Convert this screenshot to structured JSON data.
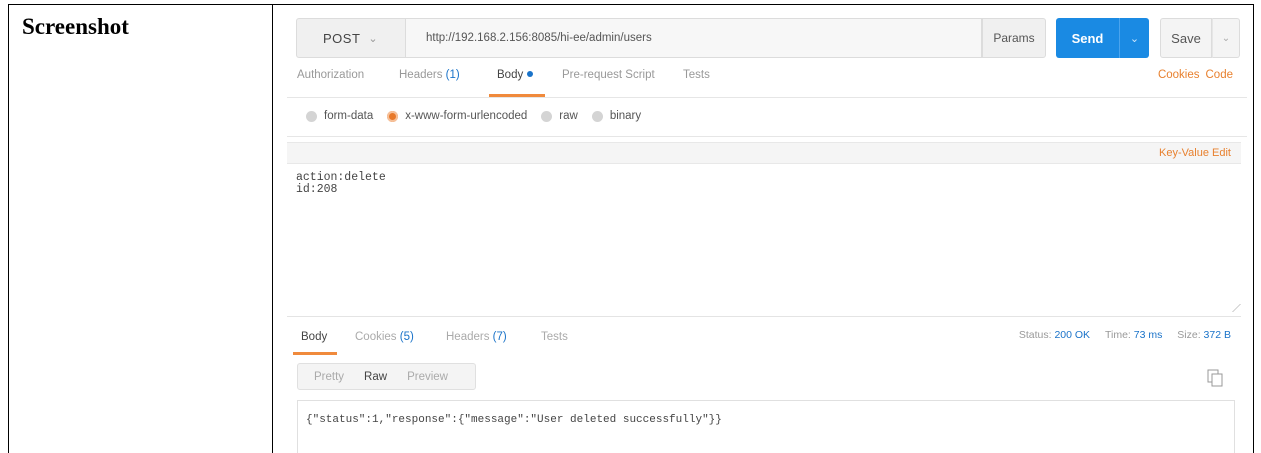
{
  "doc": {
    "label": "Screenshot"
  },
  "request": {
    "method": "POST",
    "url": "http://192.168.2.156:8085/hi-ee/admin/users",
    "params_label": "Params",
    "send_label": "Send",
    "save_label": "Save"
  },
  "request_tabs": [
    {
      "label": "Authorization"
    },
    {
      "label": "Headers",
      "count": "(1)"
    },
    {
      "label": "Body",
      "active": true
    },
    {
      "label": "Pre-request Script"
    },
    {
      "label": "Tests"
    }
  ],
  "tab_links": {
    "cookies": "Cookies",
    "code": "Code"
  },
  "body_types": [
    {
      "label": "form-data",
      "selected": false
    },
    {
      "label": "x-www-form-urlencoded",
      "selected": true
    },
    {
      "label": "raw",
      "selected": false
    },
    {
      "label": "binary",
      "selected": false
    }
  ],
  "kv_edit_label": "Key-Value Edit",
  "body_text": "action:delete\nid:208",
  "response_tabs": [
    {
      "label": "Body",
      "active": true
    },
    {
      "label": "Cookies",
      "count": "(5)"
    },
    {
      "label": "Headers",
      "count": "(7)"
    },
    {
      "label": "Tests"
    }
  ],
  "status": {
    "status_label": "Status:",
    "status_value": "200 OK",
    "time_label": "Time:",
    "time_value": "73 ms",
    "size_label": "Size:",
    "size_value": "372 B"
  },
  "view_modes": [
    "Pretty",
    "Raw",
    "Preview"
  ],
  "selected_view": "Raw",
  "response_text": "{\"status\":1,\"response\":{\"message\":\"User deleted successfully\"}}",
  "colors": {
    "accent": "#f08a3c",
    "send": "#1a8ae3",
    "link": "#1a73c9",
    "orange_link": "#e8812f"
  },
  "icons": {
    "method_chevron": "chevron-down-icon",
    "send_dropdown": "chevron-down-icon",
    "copy": "copy-icon"
  }
}
